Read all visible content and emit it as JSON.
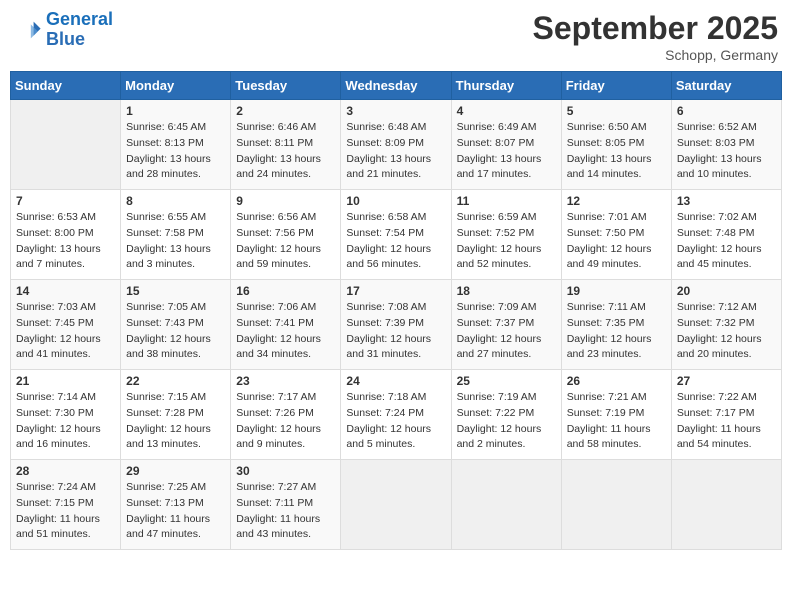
{
  "logo": {
    "line1": "General",
    "line2": "Blue"
  },
  "title": "September 2025",
  "location": "Schopp, Germany",
  "weekdays": [
    "Sunday",
    "Monday",
    "Tuesday",
    "Wednesday",
    "Thursday",
    "Friday",
    "Saturday"
  ],
  "weeks": [
    [
      {
        "day": "",
        "info": ""
      },
      {
        "day": "1",
        "info": "Sunrise: 6:45 AM\nSunset: 8:13 PM\nDaylight: 13 hours\nand 28 minutes."
      },
      {
        "day": "2",
        "info": "Sunrise: 6:46 AM\nSunset: 8:11 PM\nDaylight: 13 hours\nand 24 minutes."
      },
      {
        "day": "3",
        "info": "Sunrise: 6:48 AM\nSunset: 8:09 PM\nDaylight: 13 hours\nand 21 minutes."
      },
      {
        "day": "4",
        "info": "Sunrise: 6:49 AM\nSunset: 8:07 PM\nDaylight: 13 hours\nand 17 minutes."
      },
      {
        "day": "5",
        "info": "Sunrise: 6:50 AM\nSunset: 8:05 PM\nDaylight: 13 hours\nand 14 minutes."
      },
      {
        "day": "6",
        "info": "Sunrise: 6:52 AM\nSunset: 8:03 PM\nDaylight: 13 hours\nand 10 minutes."
      }
    ],
    [
      {
        "day": "7",
        "info": "Sunrise: 6:53 AM\nSunset: 8:00 PM\nDaylight: 13 hours\nand 7 minutes."
      },
      {
        "day": "8",
        "info": "Sunrise: 6:55 AM\nSunset: 7:58 PM\nDaylight: 13 hours\nand 3 minutes."
      },
      {
        "day": "9",
        "info": "Sunrise: 6:56 AM\nSunset: 7:56 PM\nDaylight: 12 hours\nand 59 minutes."
      },
      {
        "day": "10",
        "info": "Sunrise: 6:58 AM\nSunset: 7:54 PM\nDaylight: 12 hours\nand 56 minutes."
      },
      {
        "day": "11",
        "info": "Sunrise: 6:59 AM\nSunset: 7:52 PM\nDaylight: 12 hours\nand 52 minutes."
      },
      {
        "day": "12",
        "info": "Sunrise: 7:01 AM\nSunset: 7:50 PM\nDaylight: 12 hours\nand 49 minutes."
      },
      {
        "day": "13",
        "info": "Sunrise: 7:02 AM\nSunset: 7:48 PM\nDaylight: 12 hours\nand 45 minutes."
      }
    ],
    [
      {
        "day": "14",
        "info": "Sunrise: 7:03 AM\nSunset: 7:45 PM\nDaylight: 12 hours\nand 41 minutes."
      },
      {
        "day": "15",
        "info": "Sunrise: 7:05 AM\nSunset: 7:43 PM\nDaylight: 12 hours\nand 38 minutes."
      },
      {
        "day": "16",
        "info": "Sunrise: 7:06 AM\nSunset: 7:41 PM\nDaylight: 12 hours\nand 34 minutes."
      },
      {
        "day": "17",
        "info": "Sunrise: 7:08 AM\nSunset: 7:39 PM\nDaylight: 12 hours\nand 31 minutes."
      },
      {
        "day": "18",
        "info": "Sunrise: 7:09 AM\nSunset: 7:37 PM\nDaylight: 12 hours\nand 27 minutes."
      },
      {
        "day": "19",
        "info": "Sunrise: 7:11 AM\nSunset: 7:35 PM\nDaylight: 12 hours\nand 23 minutes."
      },
      {
        "day": "20",
        "info": "Sunrise: 7:12 AM\nSunset: 7:32 PM\nDaylight: 12 hours\nand 20 minutes."
      }
    ],
    [
      {
        "day": "21",
        "info": "Sunrise: 7:14 AM\nSunset: 7:30 PM\nDaylight: 12 hours\nand 16 minutes."
      },
      {
        "day": "22",
        "info": "Sunrise: 7:15 AM\nSunset: 7:28 PM\nDaylight: 12 hours\nand 13 minutes."
      },
      {
        "day": "23",
        "info": "Sunrise: 7:17 AM\nSunset: 7:26 PM\nDaylight: 12 hours\nand 9 minutes."
      },
      {
        "day": "24",
        "info": "Sunrise: 7:18 AM\nSunset: 7:24 PM\nDaylight: 12 hours\nand 5 minutes."
      },
      {
        "day": "25",
        "info": "Sunrise: 7:19 AM\nSunset: 7:22 PM\nDaylight: 12 hours\nand 2 minutes."
      },
      {
        "day": "26",
        "info": "Sunrise: 7:21 AM\nSunset: 7:19 PM\nDaylight: 11 hours\nand 58 minutes."
      },
      {
        "day": "27",
        "info": "Sunrise: 7:22 AM\nSunset: 7:17 PM\nDaylight: 11 hours\nand 54 minutes."
      }
    ],
    [
      {
        "day": "28",
        "info": "Sunrise: 7:24 AM\nSunset: 7:15 PM\nDaylight: 11 hours\nand 51 minutes."
      },
      {
        "day": "29",
        "info": "Sunrise: 7:25 AM\nSunset: 7:13 PM\nDaylight: 11 hours\nand 47 minutes."
      },
      {
        "day": "30",
        "info": "Sunrise: 7:27 AM\nSunset: 7:11 PM\nDaylight: 11 hours\nand 43 minutes."
      },
      {
        "day": "",
        "info": ""
      },
      {
        "day": "",
        "info": ""
      },
      {
        "day": "",
        "info": ""
      },
      {
        "day": "",
        "info": ""
      }
    ]
  ]
}
